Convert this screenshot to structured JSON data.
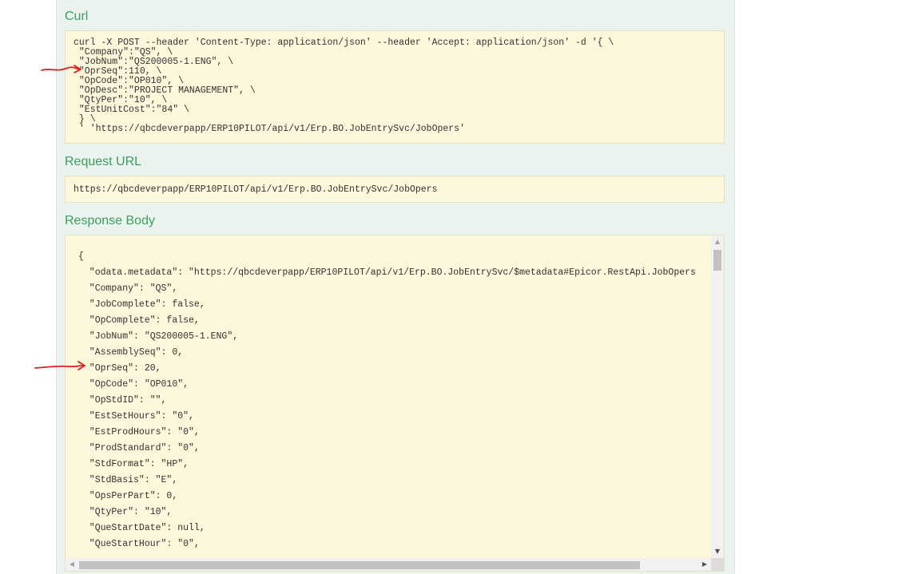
{
  "sections": {
    "curl": {
      "title": "Curl",
      "lines": [
        "curl -X POST --header 'Content-Type: application/json' --header 'Accept: application/json' -d '{ \\",
        " \"Company\":\"QS\", \\",
        " \"JobNum\":\"QS200005-1.ENG\", \\",
        " \"OprSeq\":110, \\",
        " \"OpCode\":\"OP010\", \\",
        " \"OpDesc\":\"PROJECT MANAGEMENT\", \\",
        " \"QtyPer\":\"10\", \\",
        " \"EstUnitCost\":\"84\" \\",
        " } \\",
        " ' 'https://qbcdeverpapp/ERP10PILOT/api/v1/Erp.BO.JobEntrySvc/JobOpers'"
      ]
    },
    "request_url": {
      "title": "Request URL",
      "value": "https://qbcdeverpapp/ERP10PILOT/api/v1/Erp.BO.JobEntrySvc/JobOpers"
    },
    "response_body": {
      "title": "Response Body",
      "lines": [
        "{",
        "  \"odata.metadata\": \"https://qbcdeverpapp/ERP10PILOT/api/v1/Erp.BO.JobEntrySvc/$metadata#Epicor.RestApi.JobOpers",
        "  \"Company\": \"QS\",",
        "  \"JobComplete\": false,",
        "  \"OpComplete\": false,",
        "  \"JobNum\": \"QS200005-1.ENG\",",
        "  \"AssemblySeq\": 0,",
        "  \"OprSeq\": 20,",
        "  \"OpCode\": \"OP010\",",
        "  \"OpStdID\": \"\",",
        "  \"EstSetHours\": \"0\",",
        "  \"EstProdHours\": \"0\",",
        "  \"ProdStandard\": \"0\",",
        "  \"StdFormat\": \"HP\",",
        "  \"StdBasis\": \"E\",",
        "  \"OpsPerPart\": 0,",
        "  \"QtyPer\": \"10\",",
        "  \"QueStartDate\": null,",
        "  \"QueStartHour\": \"0\","
      ]
    }
  },
  "icons": {
    "scroll_up": "▲",
    "scroll_down": "▼",
    "scroll_left": "◀",
    "scroll_right": "▶"
  },
  "colors": {
    "heading": "#3a9f5e",
    "annotation": "#e02020"
  }
}
